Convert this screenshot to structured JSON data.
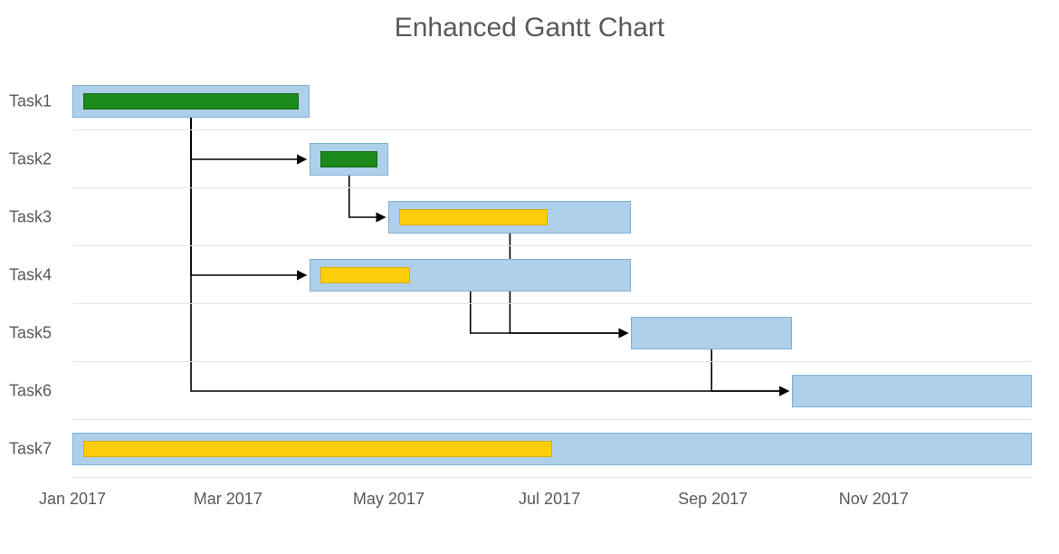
{
  "title": "Enhanced Gantt Chart",
  "axis_start": "2017-01-01",
  "axis_end": "2017-12-31",
  "x_ticks": [
    {
      "label": "Jan 2017",
      "date": "2017-01-01"
    },
    {
      "label": "Mar 2017",
      "date": "2017-03-01"
    },
    {
      "label": "May 2017",
      "date": "2017-05-01"
    },
    {
      "label": "Jul 2017",
      "date": "2017-07-01"
    },
    {
      "label": "Sep 2017",
      "date": "2017-09-01"
    },
    {
      "label": "Nov 2017",
      "date": "2017-11-01"
    }
  ],
  "tasks": [
    {
      "id": "Task1",
      "start": "2017-01-01",
      "end": "2017-04-01",
      "progress": 1.0,
      "status": "green"
    },
    {
      "id": "Task2",
      "start": "2017-04-01",
      "end": "2017-05-01",
      "progress": 1.0,
      "status": "green"
    },
    {
      "id": "Task3",
      "start": "2017-05-01",
      "end": "2017-08-01",
      "progress": 0.67,
      "status": "gold"
    },
    {
      "id": "Task4",
      "start": "2017-04-01",
      "end": "2017-08-01",
      "progress": 0.3,
      "status": "gold"
    },
    {
      "id": "Task5",
      "start": "2017-08-01",
      "end": "2017-10-01",
      "progress": 0.0,
      "status": "none"
    },
    {
      "id": "Task6",
      "start": "2017-10-01",
      "end": "2017-12-31",
      "progress": 0.0,
      "status": "none"
    },
    {
      "id": "Task7",
      "start": "2017-01-01",
      "end": "2017-12-31",
      "progress": 0.5,
      "status": "gold"
    }
  ],
  "dependencies": [
    {
      "from": "Task1",
      "to": "Task2"
    },
    {
      "from": "Task1",
      "to": "Task4"
    },
    {
      "from": "Task1",
      "to": "Task6"
    },
    {
      "from": "Task2",
      "to": "Task3"
    },
    {
      "from": "Task3",
      "to": "Task5"
    },
    {
      "from": "Task4",
      "to": "Task5"
    },
    {
      "from": "Task5",
      "to": "Task6"
    }
  ],
  "chart_data": {
    "type": "bar",
    "title": "Enhanced Gantt Chart",
    "xlabel": "",
    "ylabel": "",
    "x_range": [
      "2017-01-01",
      "2017-12-31"
    ],
    "series": [
      {
        "name": "Task1",
        "start": "2017-01-01",
        "end": "2017-04-01",
        "progress_pct": 100
      },
      {
        "name": "Task2",
        "start": "2017-04-01",
        "end": "2017-05-01",
        "progress_pct": 100
      },
      {
        "name": "Task3",
        "start": "2017-05-01",
        "end": "2017-08-01",
        "progress_pct": 67
      },
      {
        "name": "Task4",
        "start": "2017-04-01",
        "end": "2017-08-01",
        "progress_pct": 30
      },
      {
        "name": "Task5",
        "start": "2017-08-01",
        "end": "2017-10-01",
        "progress_pct": 0
      },
      {
        "name": "Task6",
        "start": "2017-10-01",
        "end": "2017-12-31",
        "progress_pct": 0
      },
      {
        "name": "Task7",
        "start": "2017-01-01",
        "end": "2017-12-31",
        "progress_pct": 50
      }
    ],
    "dependencies": [
      [
        "Task1",
        "Task2"
      ],
      [
        "Task1",
        "Task4"
      ],
      [
        "Task1",
        "Task6"
      ],
      [
        "Task2",
        "Task3"
      ],
      [
        "Task3",
        "Task5"
      ],
      [
        "Task4",
        "Task5"
      ],
      [
        "Task5",
        "Task6"
      ]
    ],
    "x_ticks": [
      "Jan 2017",
      "Mar 2017",
      "May 2017",
      "Jul 2017",
      "Sep 2017",
      "Nov 2017"
    ]
  }
}
